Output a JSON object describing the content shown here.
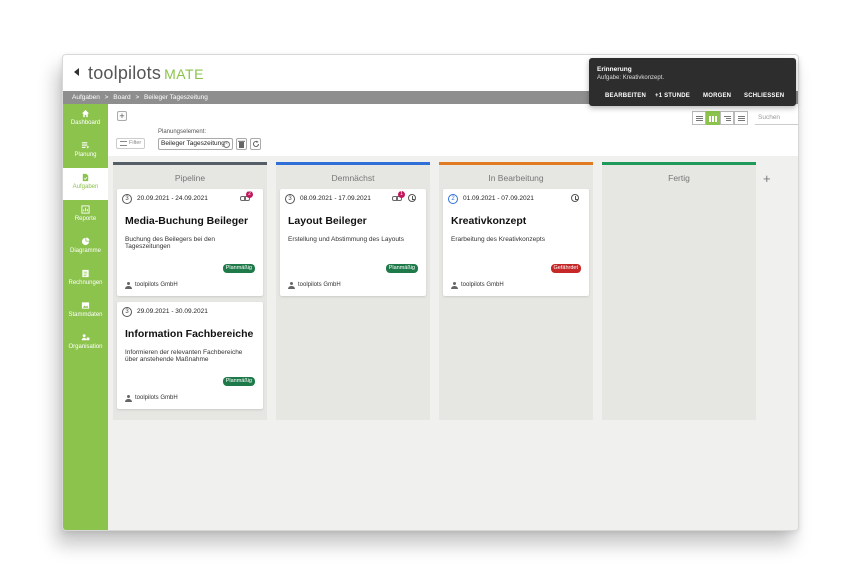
{
  "app": {
    "logo_tool": "tool",
    "logo_pilots": "pilots",
    "logo_mate": "MATE"
  },
  "breadcrumb": [
    "Aufgaben",
    ">",
    "Board",
    ">",
    "Beileger Tageszeitung"
  ],
  "sidebar": {
    "items": [
      {
        "label": "Dashboard",
        "icon": "home-icon"
      },
      {
        "label": "Planung",
        "icon": "planning-icon"
      },
      {
        "label": "Aufgaben",
        "icon": "task-icon",
        "active": true
      },
      {
        "label": "Reporte",
        "icon": "report-icon"
      },
      {
        "label": "Diagramme",
        "icon": "pie-chart-icon"
      },
      {
        "label": "Rechnungen",
        "icon": "invoice-icon"
      },
      {
        "label": "Stammdaten",
        "icon": "image-icon"
      },
      {
        "label": "Organisation",
        "icon": "org-icon"
      }
    ]
  },
  "toolbar": {
    "add_label": "+",
    "filter_label": "Filter",
    "plan_label": "Planungselement:",
    "plan_value": "Beileger Tageszeitung",
    "search_placeholder": "Suchen"
  },
  "columns": [
    {
      "title": "Pipeline",
      "color": "#555e66"
    },
    {
      "title": "Demnächst",
      "color": "#2f6fd6"
    },
    {
      "title": "In Bearbeitung",
      "color": "#e07b22"
    },
    {
      "title": "Fertig",
      "color": "#1f9a5a"
    }
  ],
  "add_column": "+",
  "cards": {
    "media": {
      "num": "3",
      "dates": "20.09.2021 - 24.09.2021",
      "links": "2",
      "title": "Media-Buchung Beileger",
      "desc": "Buchung des Beilegers bei den Tageszeitungen",
      "status": "Planmäßig",
      "owner": "toolpilots GmbH"
    },
    "info": {
      "num": "3",
      "dates": "29.09.2021 - 30.09.2021",
      "title": "Information Fachbereiche",
      "desc": "Informieren der relevanten Fachbereiche über anstehende Maßnahme",
      "status": "Planmäßig",
      "owner": "toolpilots GmbH"
    },
    "layout": {
      "num": "3",
      "dates": "08.09.2021 - 17.09.2021",
      "links": "1",
      "title": "Layout Beileger",
      "desc": "Erstellung und Abstimmung des Layouts",
      "status": "Planmäßig",
      "owner": "toolpilots GmbH"
    },
    "kreativ": {
      "num": "2",
      "dates": "01.09.2021 - 07.09.2021",
      "title": "Kreativkonzept",
      "desc": "Erarbeitung des Kreativkonzepts",
      "status": "Gefährdet",
      "owner": "toolpilots GmbH"
    }
  },
  "toast": {
    "title": "Erinnerung",
    "message": "Aufgabe: Kreativkonzept.",
    "actions": [
      "BEARBEITEN",
      "+1 STUNDE",
      "MORGEN",
      "SCHLIESSEN"
    ]
  }
}
